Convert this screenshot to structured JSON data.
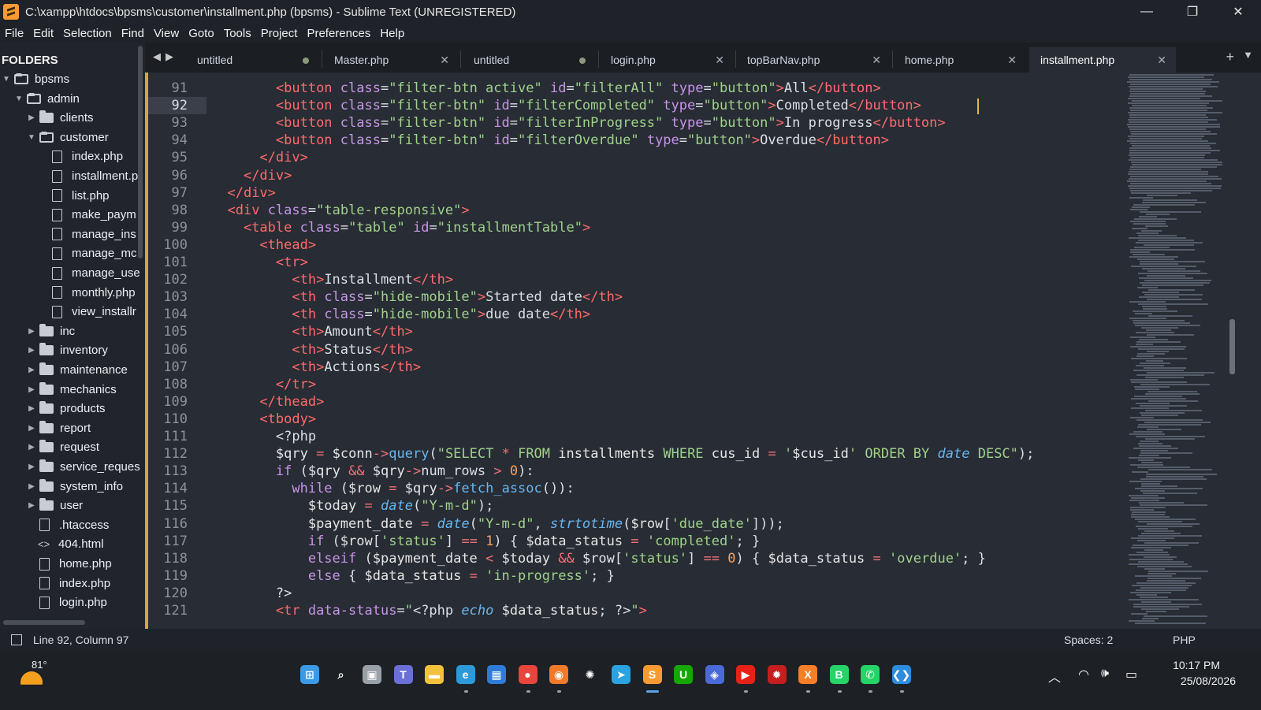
{
  "window": {
    "title": "C:\\xampp\\htdocs\\bpsms\\customer\\installment.php (bpsms) - Sublime Text (UNREGISTERED)",
    "minimize": "—",
    "maximize": "❐",
    "close": "✕"
  },
  "menu": [
    "File",
    "Edit",
    "Selection",
    "Find",
    "View",
    "Goto",
    "Tools",
    "Project",
    "Preferences",
    "Help"
  ],
  "sidebar": {
    "header": "FOLDERS",
    "items": [
      {
        "label": "bpsms",
        "type": "folder-open",
        "depth": 0
      },
      {
        "label": "admin",
        "type": "folder-open",
        "depth": 1
      },
      {
        "label": "clients",
        "type": "folder",
        "depth": 2
      },
      {
        "label": "customer",
        "type": "folder-open",
        "depth": 2
      },
      {
        "label": "index.php",
        "type": "file",
        "depth": 3
      },
      {
        "label": "installment.p",
        "type": "file",
        "depth": 3
      },
      {
        "label": "list.php",
        "type": "file",
        "depth": 3
      },
      {
        "label": "make_paym",
        "type": "file",
        "depth": 3
      },
      {
        "label": "manage_ins",
        "type": "file",
        "depth": 3
      },
      {
        "label": "manage_mc",
        "type": "file",
        "depth": 3
      },
      {
        "label": "manage_use",
        "type": "file",
        "depth": 3
      },
      {
        "label": "monthly.php",
        "type": "file",
        "depth": 3
      },
      {
        "label": "view_installr",
        "type": "file",
        "depth": 3
      },
      {
        "label": "inc",
        "type": "folder",
        "depth": 2
      },
      {
        "label": "inventory",
        "type": "folder",
        "depth": 2
      },
      {
        "label": "maintenance",
        "type": "folder",
        "depth": 2
      },
      {
        "label": "mechanics",
        "type": "folder",
        "depth": 2
      },
      {
        "label": "products",
        "type": "folder",
        "depth": 2
      },
      {
        "label": "report",
        "type": "folder",
        "depth": 2
      },
      {
        "label": "request",
        "type": "folder",
        "depth": 2
      },
      {
        "label": "service_reques",
        "type": "folder",
        "depth": 2
      },
      {
        "label": "system_info",
        "type": "folder",
        "depth": 2
      },
      {
        "label": "user",
        "type": "folder",
        "depth": 2
      },
      {
        "label": ".htaccess",
        "type": "file",
        "depth": 2
      },
      {
        "label": "404.html",
        "type": "code",
        "depth": 2
      },
      {
        "label": "home.php",
        "type": "file",
        "depth": 2
      },
      {
        "label": "index.php",
        "type": "file",
        "depth": 2
      },
      {
        "label": "login.php",
        "type": "file",
        "depth": 2
      }
    ]
  },
  "tabs": [
    {
      "label": "untitled",
      "state": "dirty"
    },
    {
      "label": "Master.php",
      "state": "close"
    },
    {
      "label": "untitled",
      "state": "dirty"
    },
    {
      "label": "login.php",
      "state": "close"
    },
    {
      "label": "topBarNav.php",
      "state": "close"
    },
    {
      "label": "home.php",
      "state": "close"
    },
    {
      "label": "installment.php",
      "state": "active"
    }
  ],
  "editor": {
    "current_line": 92,
    "lines": [
      {
        "n": "91",
        "html": "        <span class='t'>&lt;button</span> <span class='a'>class</span><span class='p'>=</span><span class='s'>\"filter-btn active\"</span> <span class='a'>id</span><span class='p'>=</span><span class='s'>\"filterAll\"</span> <span class='a'>type</span><span class='p'>=</span><span class='s'>\"button\"</span><span class='t'>&gt;</span>All<span class='t'>&lt;/button&gt;</span>"
      },
      {
        "n": "92",
        "html": "        <span class='t'>&lt;button</span> <span class='a'>class</span><span class='p'>=</span><span class='s'>\"filter-btn\"</span> <span class='a'>id</span><span class='p'>=</span><span class='s'>\"filterCompleted\"</span> <span class='a'>type</span><span class='p'>=</span><span class='s'>\"button\"</span><span class='t'>&gt;</span>Completed<span class='t'>&lt;/button&gt;</span>"
      },
      {
        "n": "93",
        "html": "        <span class='t'>&lt;button</span> <span class='a'>class</span><span class='p'>=</span><span class='s'>\"filter-btn\"</span> <span class='a'>id</span><span class='p'>=</span><span class='s'>\"filterInProgress\"</span> <span class='a'>type</span><span class='p'>=</span><span class='s'>\"button\"</span><span class='t'>&gt;</span>In progress<span class='t'>&lt;/button&gt;</span>"
      },
      {
        "n": "94",
        "html": "        <span class='t'>&lt;button</span> <span class='a'>class</span><span class='p'>=</span><span class='s'>\"filter-btn\"</span> <span class='a'>id</span><span class='p'>=</span><span class='s'>\"filterOverdue\"</span> <span class='a'>type</span><span class='p'>=</span><span class='s'>\"button\"</span><span class='t'>&gt;</span>Overdue<span class='t'>&lt;/button&gt;</span>"
      },
      {
        "n": "95",
        "html": "      <span class='t'>&lt;/div&gt;</span>"
      },
      {
        "n": "96",
        "html": "    <span class='t'>&lt;/div&gt;</span>"
      },
      {
        "n": "97",
        "html": "  <span class='t'>&lt;/div&gt;</span>"
      },
      {
        "n": "98",
        "html": "  <span class='t'>&lt;div</span> <span class='a'>class</span><span class='p'>=</span><span class='s'>\"table-responsive\"</span><span class='t'>&gt;</span>"
      },
      {
        "n": "99",
        "html": "    <span class='t'>&lt;table</span> <span class='a'>class</span><span class='p'>=</span><span class='s'>\"table\"</span> <span class='a'>id</span><span class='p'>=</span><span class='s'>\"installmentTable\"</span><span class='t'>&gt;</span>"
      },
      {
        "n": "100",
        "html": "      <span class='t'>&lt;thead&gt;</span>"
      },
      {
        "n": "101",
        "html": "        <span class='t'>&lt;tr&gt;</span>"
      },
      {
        "n": "102",
        "html": "          <span class='t'>&lt;th&gt;</span>Installment<span class='t'>&lt;/th&gt;</span>"
      },
      {
        "n": "103",
        "html": "          <span class='t'>&lt;th</span> <span class='a'>class</span><span class='p'>=</span><span class='s'>\"hide-mobile\"</span><span class='t'>&gt;</span>Started date<span class='t'>&lt;/th&gt;</span>"
      },
      {
        "n": "104",
        "html": "          <span class='t'>&lt;th</span> <span class='a'>class</span><span class='p'>=</span><span class='s'>\"hide-mobile\"</span><span class='t'>&gt;</span>due date<span class='t'>&lt;/th&gt;</span>"
      },
      {
        "n": "105",
        "html": "          <span class='t'>&lt;th&gt;</span>Amount<span class='t'>&lt;/th&gt;</span>"
      },
      {
        "n": "106",
        "html": "          <span class='t'>&lt;th&gt;</span>Status<span class='t'>&lt;/th&gt;</span>"
      },
      {
        "n": "107",
        "html": "          <span class='t'>&lt;th&gt;</span>Actions<span class='t'>&lt;/th&gt;</span>"
      },
      {
        "n": "108",
        "html": "        <span class='t'>&lt;/tr&gt;</span>"
      },
      {
        "n": "109",
        "html": "      <span class='t'>&lt;/thead&gt;</span>"
      },
      {
        "n": "110",
        "html": "      <span class='t'>&lt;tbody&gt;</span>"
      },
      {
        "n": "111",
        "html": "        <span class='p'>&lt;?php</span>"
      },
      {
        "n": "112",
        "html": "        <span class='v'>$qry</span> <span class='op'>=</span> <span class='v'>$conn</span><span class='op'>-&gt;</span><span class='f'>query</span>(<span class='s'>\"SELECT <span class='op'>*</span> FROM</span> <span class='v'>installments</span> <span class='s'>WHERE</span> <span class='v'>cus_id</span> <span class='op'>=</span> <span class='s'>'</span><span class='v'>$cus_id</span><span class='s'>'</span> <span class='s'>ORDER BY</span> <span class='it'>date</span> <span class='s'>DESC\"</span>);"
      },
      {
        "n": "113",
        "html": "        <span class='k'>if</span> (<span class='v'>$qry</span> <span class='op'>&amp;&amp;</span> <span class='v'>$qry</span><span class='op'>-&gt;</span>num_rows <span class='op'>&gt;</span> <span class='n'>0</span>):"
      },
      {
        "n": "114",
        "html": "          <span class='k'>while</span> (<span class='v'>$row</span> <span class='op'>=</span> <span class='v'>$qry</span><span class='op'>-&gt;</span><span class='f'>fetch_assoc</span>()):"
      },
      {
        "n": "115",
        "html": "            <span class='v'>$today</span> <span class='op'>=</span> <span class='it'>date</span>(<span class='s'>\"Y-m-d\"</span>);"
      },
      {
        "n": "116",
        "html": "            <span class='v'>$payment_date</span> <span class='op'>=</span> <span class='it'>date</span>(<span class='s'>\"Y-m-d\"</span>, <span class='it'>strtotime</span>(<span class='v'>$row</span>[<span class='s'>'due_date'</span>]));"
      },
      {
        "n": "117",
        "html": "            <span class='k'>if</span> (<span class='v'>$row</span>[<span class='s'>'status'</span>] <span class='op'>==</span> <span class='n'>1</span>) { <span class='v'>$data_status</span> <span class='op'>=</span> <span class='s'>'completed'</span>; }"
      },
      {
        "n": "118",
        "html": "            <span class='k'>elseif</span> (<span class='v'>$payment_date</span> <span class='op'>&lt;</span> <span class='v'>$today</span> <span class='op'>&amp;&amp;</span> <span class='v'>$row</span>[<span class='s'>'status'</span>] <span class='op'>==</span> <span class='n'>0</span>) { <span class='v'>$data_status</span> <span class='op'>=</span> <span class='s'>'overdue'</span>; }"
      },
      {
        "n": "119",
        "html": "            <span class='k'>else</span> { <span class='v'>$data_status</span> <span class='op'>=</span> <span class='s'>'in-progress'</span>; }"
      },
      {
        "n": "120",
        "html": "        <span class='p'>?&gt;</span>"
      },
      {
        "n": "121",
        "html": "        <span class='t'>&lt;tr</span> <span class='a'>data-status</span><span class='p'>=</span><span class='s'>\"</span><span class='p'>&lt;?php</span> <span class='it'>echo</span> <span class='v'>$data_status</span>; <span class='p'>?&gt;</span><span class='s'>\"</span><span class='t'>&gt;</span>"
      }
    ]
  },
  "status": {
    "position": "Line 92, Column 97",
    "spaces": "Spaces: 2",
    "syntax": "PHP"
  },
  "taskbar": {
    "temperature": "81°",
    "time": "10:17 PM",
    "date": "25/08/2026",
    "apps": [
      {
        "name": "start-icon",
        "color": "#3b9ae8",
        "glyph": "⊞"
      },
      {
        "name": "search-icon",
        "color": "transparent",
        "glyph": "⌕"
      },
      {
        "name": "task-view-icon",
        "color": "#9aa0a8",
        "glyph": "▣"
      },
      {
        "name": "teams-icon",
        "color": "#6b6fd8",
        "glyph": "T"
      },
      {
        "name": "file-explorer-icon",
        "color": "#f3c23c",
        "glyph": "▬"
      },
      {
        "name": "edge-icon",
        "color": "#2c9ad9",
        "glyph": "e"
      },
      {
        "name": "store-icon",
        "color": "#2f7bd8",
        "glyph": "▦"
      },
      {
        "name": "chrome-icon",
        "color": "#e8453c",
        "glyph": "●"
      },
      {
        "name": "firefox-icon",
        "color": "#f07a2a",
        "glyph": "◉"
      },
      {
        "name": "chatgpt-icon",
        "color": "transparent",
        "glyph": "✺"
      },
      {
        "name": "telegram-icon",
        "color": "#2aa3e0",
        "glyph": "➤"
      },
      {
        "name": "sublime-icon",
        "color": "#f79a32",
        "glyph": "S"
      },
      {
        "name": "upwork-icon",
        "color": "#14a800",
        "glyph": "U"
      },
      {
        "name": "vpn-icon",
        "color": "#4a6ad8",
        "glyph": "◈"
      },
      {
        "name": "youtube-icon",
        "color": "#e62117",
        "glyph": "▶"
      },
      {
        "name": "virus-shield-icon",
        "color": "#c41e1e",
        "glyph": "✹"
      },
      {
        "name": "xampp-icon",
        "color": "#f57e26",
        "glyph": "X"
      },
      {
        "name": "whatsapp-business-icon",
        "color": "#25d366",
        "glyph": "B"
      },
      {
        "name": "whatsapp-icon",
        "color": "#25d366",
        "glyph": "✆"
      },
      {
        "name": "vscode-icon",
        "color": "#2c8ce0",
        "glyph": "❮❯"
      }
    ]
  }
}
